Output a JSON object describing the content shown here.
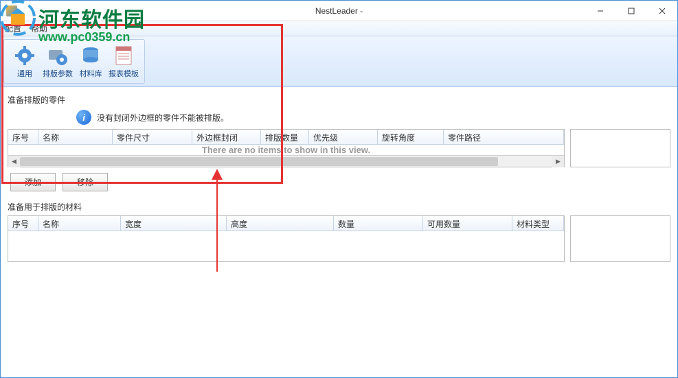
{
  "window": {
    "title": "NestLeader -"
  },
  "menu": {
    "config": "配置",
    "help": "帮助"
  },
  "toolbar": {
    "general": "通用",
    "nest_params": "排版参数",
    "material_lib": "材料库",
    "report_tpl": "报表模板"
  },
  "watermark": {
    "site_name": "河东软件园",
    "url": "www.pc0359.cn"
  },
  "parts_section": {
    "label": "准备排版的零件",
    "info_text": "没有封闭外边框的零件不能被排版。",
    "columns": {
      "seq": "序号",
      "name": "名称",
      "size": "零件尺寸",
      "closed": "外边框封闭",
      "qty": "排版数量",
      "priority": "优先级",
      "rotation": "旋转角度",
      "path": "零件路径"
    },
    "empty": "There are no items to show in this view.",
    "add": "添加",
    "remove": "移除"
  },
  "materials_section": {
    "label": "准备用于排版的材料",
    "columns": {
      "seq": "序号",
      "name": "名称",
      "width": "宽度",
      "height": "高度",
      "qty": "数量",
      "avail": "可用数量",
      "type": "材料类型"
    }
  }
}
